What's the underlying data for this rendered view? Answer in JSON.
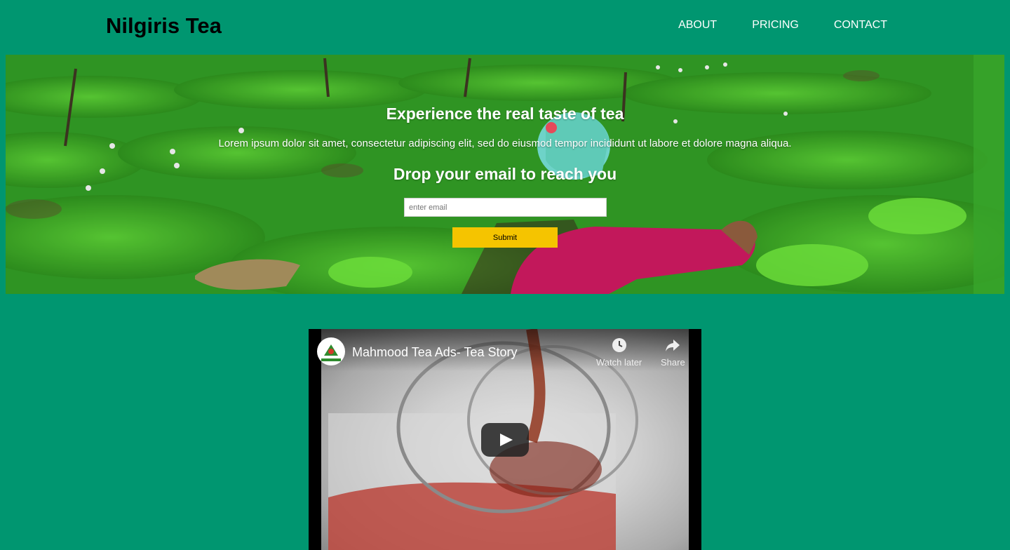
{
  "header": {
    "brand": "Nilgiris Tea",
    "nav": [
      "ABOUT",
      "PRICING",
      "CONTACT"
    ]
  },
  "hero": {
    "title": "Experience the real taste of tea",
    "description": "Lorem ipsum dolor sit amet, consectetur adipiscing elit, sed do eiusmod tempor incididunt ut labore et dolore magna aliqua.",
    "subtitle": "Drop your email to reach you",
    "email_placeholder": "enter email",
    "submit_label": "Submit"
  },
  "video": {
    "title": "Mahmood Tea Ads- Tea Story",
    "watch_later": "Watch later",
    "share": "Share"
  },
  "colors": {
    "background": "#009670",
    "submit": "#f5c400"
  },
  "icons": {
    "play": "play-icon",
    "clock": "clock-icon",
    "share": "share-icon"
  }
}
